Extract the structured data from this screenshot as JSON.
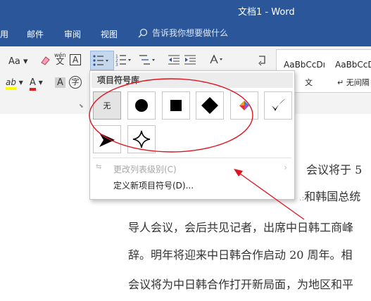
{
  "window": {
    "title": "文档1  -  Word"
  },
  "menu": {
    "tabs": [
      "用",
      "邮件",
      "审阅",
      "视图"
    ],
    "tell_me": "告诉我你想要做什么"
  },
  "ribbon": {
    "font_aa": "Aa",
    "phonetic_label": "wén",
    "phonetic_char": "文",
    "box_a": "A",
    "highlight": "ab",
    "font_color": "A",
    "shading_a": "A",
    "char_border": "字",
    "styles": [
      {
        "sample": "AaBbCcDı",
        "name": "文"
      },
      {
        "sample": "AaBbCcDı",
        "name": "无间隔"
      }
    ]
  },
  "bullet_library": {
    "header": "项目符号库",
    "none_label": "无",
    "bullets": [
      {
        "icon": "none",
        "selected": true
      },
      {
        "icon": "filled-circle-icon"
      },
      {
        "icon": "filled-square-icon"
      },
      {
        "icon": "filled-diamond-icon"
      },
      {
        "icon": "four-color-diamond-icon"
      },
      {
        "icon": "checkmark-icon"
      },
      {
        "icon": "arrowhead-icon"
      },
      {
        "icon": "four-point-star-icon"
      }
    ],
    "change_level": "更改列表级别(C)",
    "define_new": "定义新项目符号(D)..."
  },
  "document": {
    "lines": [
      "会议将于 5",
      "和韩国总统",
      "导人会议，会后共见记者，出席中日韩工商峰",
      "辞。明年将迎来中日韩合作启动 20 周年。相",
      "会议将为中日韩合作打开新局面，为地区和平"
    ]
  },
  "colors": {
    "titlebar": "#2b579a",
    "annotation": "#e0141e"
  }
}
